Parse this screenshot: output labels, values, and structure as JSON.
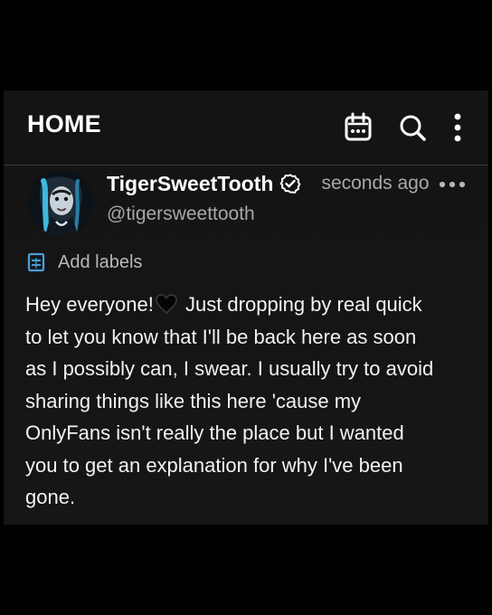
{
  "header": {
    "title": "HOME",
    "icons": [
      "calendar-icon",
      "search-icon",
      "more-vertical-icon"
    ]
  },
  "post": {
    "author": {
      "display_name": "TigerSweetTooth",
      "username": "@tigersweettooth",
      "verified_icon": "verified-badge-icon"
    },
    "timestamp": "seconds ago",
    "menu_icon": "more-horizontal-icon",
    "labels": {
      "icon": "label-icon",
      "text": "Add labels"
    },
    "body": {
      "before_emoji": "Hey everyone!",
      "emoji_name": "black-heart",
      "after_emoji": " Just dropping by real quick\nto let you know that I'll be back here as soon\nas I possibly can, I swear. I usually try to avoid\nsharing things like this here 'cause my\nOnlyFans isn't really the place but I wanted\nyou to get an explanation for why I've been\ngone."
    }
  },
  "colors": {
    "page_background": "#000000",
    "screen_background": "#141414",
    "text_primary": "#ffffff",
    "text_secondary": "#a8a8a8",
    "accent_blue": "#4a9fd8"
  }
}
